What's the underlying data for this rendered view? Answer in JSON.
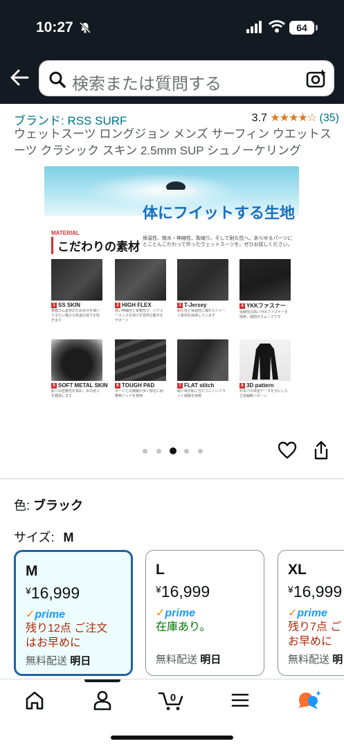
{
  "status_bar": {
    "time": "10:27",
    "battery": "64"
  },
  "search": {
    "placeholder": "検索または質問する"
  },
  "product": {
    "brand": "ブランド: RSS SURF",
    "rating_value": "3.7",
    "rating_stars": "★★★★☆",
    "rating_count": "(35)",
    "title": "ウェットスーツ ロングジョン メンズ サーフィン ウエットスーツ クラシック スキン 2.5mm SUP シュノーケリング"
  },
  "image": {
    "fit_text_a": "体にフイット",
    "fit_text_b": "する生地",
    "material_tag": "MATERIAL",
    "material_title": "こだわりの素材",
    "material_desc": "保温性、撥水・伸縮性、製縮り、そして耐久性へ。あらゆるパーツにとことんこだわって作ったウェットスーツを、ぜひお試しください。",
    "tiles": [
      {
        "num": "1",
        "label": "SS SKIN",
        "desc": "表面ゴム素材のため水分を弾いて冷たい風から体温の低下を防ぎます"
      },
      {
        "num": "2",
        "label": "HIGH FLEX",
        "desc": "高い伸縮性と柔軟性で、パフォーマンスを妨げず自然な動きをサポート"
      },
      {
        "num": "3",
        "label": "T-Jersey",
        "desc": "耐久性と保温性に優れたジャージ素材を採用しています"
      },
      {
        "num": "4",
        "label": "YKKファスナー",
        "desc": "信頼性の高いYKKファスナーを採用、開閉がスムーズです"
      },
      {
        "num": "5",
        "label": "SOFT METAL SKIN",
        "desc": "肌への密着性を高め、水の侵入を軽減します"
      },
      {
        "num": "6",
        "label": "TOUGH PAD",
        "desc": "ボードとの接触が多い部位に耐摩耗パッドを使用"
      },
      {
        "num": "7",
        "label": "FLAT stitch",
        "desc": "縫い目が肌に当たりにくいフラット縫製を採用"
      },
      {
        "num": "8",
        "label": "3D pattern",
        "desc": "日本人の体型データを元にした立体裁断パターン"
      }
    ],
    "carousel_count": 5,
    "carousel_active": 3
  },
  "variation": {
    "color_label": "色:",
    "color_value": "ブラック",
    "size_label": "サイズ:",
    "size_value": "M"
  },
  "sizes": [
    {
      "size": "M",
      "yen": "¥",
      "price": "16,999",
      "prime": "prime",
      "stock_1": "残り12点 ご注文",
      "stock_2": "はお早めに",
      "ship": "無料配送",
      "ship_when": "明日"
    },
    {
      "size": "L",
      "yen": "¥",
      "price": "16,999",
      "prime": "prime",
      "stock_1": "在庫あり。",
      "stock_2": "",
      "ship": "無料配送",
      "ship_when": "明日"
    },
    {
      "size": "XL",
      "yen": "¥",
      "price": "16,999",
      "prime": "prime",
      "stock_1": "残り7点 ご",
      "stock_2": "お早めに",
      "ship": "無料配送",
      "ship_when": "明"
    }
  ],
  "nav": {
    "cart_count": "0"
  },
  "colors": {
    "header_bg": "#131a22",
    "link": "#007185",
    "star": "#de7921",
    "warn": "#b12704",
    "ok": "#007600",
    "selected_border": "#2162a1",
    "prime_blue": "#1a98ff"
  }
}
